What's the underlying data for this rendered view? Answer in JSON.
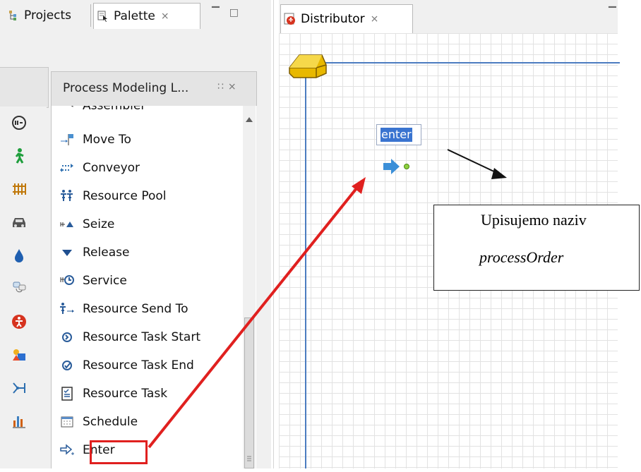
{
  "left_tabs": [
    {
      "label": "Projects",
      "icon": "projects-icon"
    },
    {
      "label": "Palette",
      "icon": "palette-icon",
      "close": "⨯"
    }
  ],
  "palette": {
    "title": "Process Modeling L...",
    "side_icons": [
      "process-modeling-icon",
      "pedestrian-icon",
      "rail-icon",
      "road-traffic-icon",
      "fluid-icon",
      "statechart-icon",
      "agent-icon",
      "presentation-icon",
      "space-markup-icon",
      "analysis-icon"
    ],
    "items": [
      {
        "label": "Assembler",
        "icon": "assembler-icon"
      },
      {
        "label": "Move To",
        "icon": "move-to-icon"
      },
      {
        "label": "Conveyor",
        "icon": "conveyor-icon"
      },
      {
        "label": "Resource Pool",
        "icon": "resource-pool-icon"
      },
      {
        "label": "Seize",
        "icon": "seize-icon"
      },
      {
        "label": "Release",
        "icon": "release-icon"
      },
      {
        "label": "Service",
        "icon": "service-icon"
      },
      {
        "label": "Resource Send To",
        "icon": "resource-send-to-icon"
      },
      {
        "label": "Resource Task Start",
        "icon": "resource-task-start-icon"
      },
      {
        "label": "Resource Task End",
        "icon": "resource-task-end-icon"
      },
      {
        "label": "Resource Task",
        "icon": "resource-task-icon"
      },
      {
        "label": "Schedule",
        "icon": "schedule-icon"
      },
      {
        "label": "Enter",
        "icon": "enter-icon"
      }
    ]
  },
  "editor": {
    "tab_label": "Distributor",
    "tab_icon": "agent-type-icon",
    "name_input": "enter"
  },
  "callout": {
    "line1": "Upisujemo naziv",
    "line2": "processOrder"
  },
  "colors": {
    "annotation_red": "#e0201f",
    "selection_blue": "#3a74d0",
    "axis_blue": "#4c7cc0",
    "enter_arrow": "#3b8fd8"
  }
}
